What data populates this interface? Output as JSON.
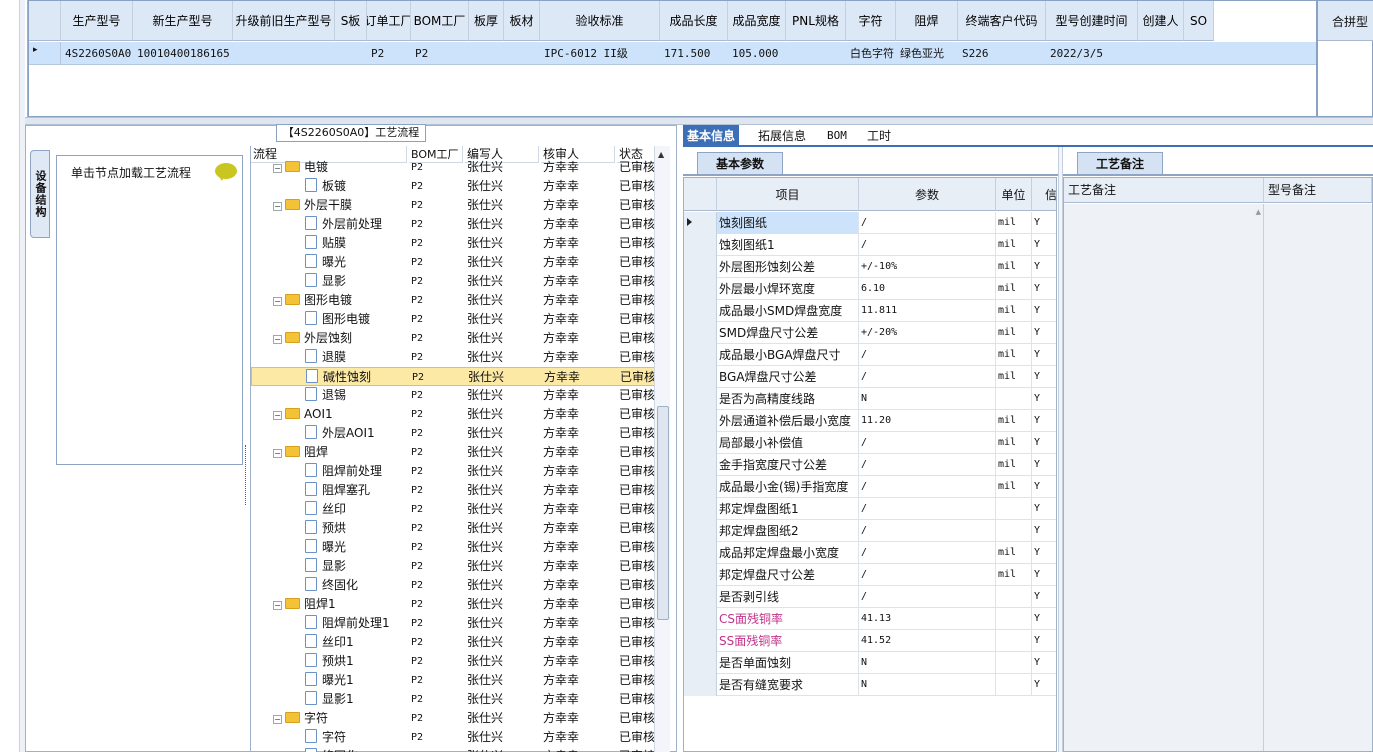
{
  "top_table": {
    "headers": [
      "生产型号",
      "新生产型号",
      "升级前旧生产型号",
      "S板",
      "订单工厂",
      "BOM工厂",
      "板厚",
      "板材",
      "验收标准",
      "成品长度",
      "成品宽度",
      "PNL规格",
      "字符",
      "阻焊",
      "终端客户代码",
      "型号创建时间",
      "创建人",
      "SO"
    ],
    "row": {
      "marker": "▸",
      "cells": [
        "4S2260S0A0",
        "10010400186165",
        "",
        "",
        "P2",
        "P2",
        "",
        "",
        "IPC-6012 II级",
        "171.500",
        "105.000",
        "",
        "白色字符",
        "绿色亚光",
        "S226",
        "2022/3/5",
        "",
        ""
      ]
    },
    "right_header": "合拼型"
  },
  "flow": {
    "title": "【4S2260S0A0】工艺流程",
    "vertical_tab": "设备结构",
    "node_hint": "单击节点加载工艺流程",
    "headers": [
      "流程",
      "BOM工厂",
      "编写人",
      "核审人",
      "状态"
    ],
    "rows": [
      {
        "name": "电镀",
        "type": "folder",
        "level": 0,
        "toggle": "−",
        "bom": "P2",
        "writer": "张仕兴",
        "reviewer": "方幸幸",
        "status": "已审核",
        "selected": false
      },
      {
        "name": "板镀",
        "type": "doc",
        "level": 1,
        "bom": "P2",
        "writer": "张仕兴",
        "reviewer": "方幸幸",
        "status": "已审核",
        "selected": false
      },
      {
        "name": "外层干膜",
        "type": "folder",
        "level": 0,
        "toggle": "−",
        "bom": "P2",
        "writer": "张仕兴",
        "reviewer": "方幸幸",
        "status": "已审核",
        "selected": false
      },
      {
        "name": "外层前处理",
        "type": "doc",
        "level": 1,
        "bom": "P2",
        "writer": "张仕兴",
        "reviewer": "方幸幸",
        "status": "已审核",
        "selected": false
      },
      {
        "name": "贴膜",
        "type": "doc",
        "level": 1,
        "bom": "P2",
        "writer": "张仕兴",
        "reviewer": "方幸幸",
        "status": "已审核",
        "selected": false
      },
      {
        "name": "曝光",
        "type": "doc",
        "level": 1,
        "bom": "P2",
        "writer": "张仕兴",
        "reviewer": "方幸幸",
        "status": "已审核",
        "selected": false
      },
      {
        "name": "显影",
        "type": "doc",
        "level": 1,
        "bom": "P2",
        "writer": "张仕兴",
        "reviewer": "方幸幸",
        "status": "已审核",
        "selected": false
      },
      {
        "name": "图形电镀",
        "type": "folder",
        "level": 0,
        "toggle": "−",
        "bom": "P2",
        "writer": "张仕兴",
        "reviewer": "方幸幸",
        "status": "已审核",
        "selected": false
      },
      {
        "name": "图形电镀",
        "type": "doc",
        "level": 1,
        "bom": "P2",
        "writer": "张仕兴",
        "reviewer": "方幸幸",
        "status": "已审核",
        "selected": false
      },
      {
        "name": "外层蚀刻",
        "type": "folder",
        "level": 0,
        "toggle": "−",
        "bom": "P2",
        "writer": "张仕兴",
        "reviewer": "方幸幸",
        "status": "已审核",
        "selected": false
      },
      {
        "name": "退膜",
        "type": "doc",
        "level": 1,
        "bom": "P2",
        "writer": "张仕兴",
        "reviewer": "方幸幸",
        "status": "已审核",
        "selected": false
      },
      {
        "name": "碱性蚀刻",
        "type": "doc",
        "level": 1,
        "bom": "P2",
        "writer": "张仕兴",
        "reviewer": "方幸幸",
        "status": "已审核",
        "selected": true
      },
      {
        "name": "退锡",
        "type": "doc",
        "level": 1,
        "bom": "P2",
        "writer": "张仕兴",
        "reviewer": "方幸幸",
        "status": "已审核",
        "selected": false
      },
      {
        "name": "AOI1",
        "type": "folder",
        "level": 0,
        "toggle": "−",
        "bom": "P2",
        "writer": "张仕兴",
        "reviewer": "方幸幸",
        "status": "已审核",
        "selected": false
      },
      {
        "name": "外层AOI1",
        "type": "doc",
        "level": 1,
        "bom": "P2",
        "writer": "张仕兴",
        "reviewer": "方幸幸",
        "status": "已审核",
        "selected": false
      },
      {
        "name": "阻焊",
        "type": "folder",
        "level": 0,
        "toggle": "−",
        "bom": "P2",
        "writer": "张仕兴",
        "reviewer": "方幸幸",
        "status": "已审核",
        "selected": false
      },
      {
        "name": "阻焊前处理",
        "type": "doc",
        "level": 1,
        "bom": "P2",
        "writer": "张仕兴",
        "reviewer": "方幸幸",
        "status": "已审核",
        "selected": false
      },
      {
        "name": "阻焊塞孔",
        "type": "doc",
        "level": 1,
        "bom": "P2",
        "writer": "张仕兴",
        "reviewer": "方幸幸",
        "status": "已审核",
        "selected": false
      },
      {
        "name": "丝印",
        "type": "doc",
        "level": 1,
        "bom": "P2",
        "writer": "张仕兴",
        "reviewer": "方幸幸",
        "status": "已审核",
        "selected": false
      },
      {
        "name": "预烘",
        "type": "doc",
        "level": 1,
        "bom": "P2",
        "writer": "张仕兴",
        "reviewer": "方幸幸",
        "status": "已审核",
        "selected": false
      },
      {
        "name": "曝光",
        "type": "doc",
        "level": 1,
        "bom": "P2",
        "writer": "张仕兴",
        "reviewer": "方幸幸",
        "status": "已审核",
        "selected": false
      },
      {
        "name": "显影",
        "type": "doc",
        "level": 1,
        "bom": "P2",
        "writer": "张仕兴",
        "reviewer": "方幸幸",
        "status": "已审核",
        "selected": false
      },
      {
        "name": "终固化",
        "type": "doc",
        "level": 1,
        "bom": "P2",
        "writer": "张仕兴",
        "reviewer": "方幸幸",
        "status": "已审核",
        "selected": false
      },
      {
        "name": "阻焊1",
        "type": "folder",
        "level": 0,
        "toggle": "−",
        "bom": "P2",
        "writer": "张仕兴",
        "reviewer": "方幸幸",
        "status": "已审核",
        "selected": false
      },
      {
        "name": "阻焊前处理1",
        "type": "doc",
        "level": 1,
        "bom": "P2",
        "writer": "张仕兴",
        "reviewer": "方幸幸",
        "status": "已审核",
        "selected": false
      },
      {
        "name": "丝印1",
        "type": "doc",
        "level": 1,
        "bom": "P2",
        "writer": "张仕兴",
        "reviewer": "方幸幸",
        "status": "已审核",
        "selected": false
      },
      {
        "name": "预烘1",
        "type": "doc",
        "level": 1,
        "bom": "P2",
        "writer": "张仕兴",
        "reviewer": "方幸幸",
        "status": "已审核",
        "selected": false
      },
      {
        "name": "曝光1",
        "type": "doc",
        "level": 1,
        "bom": "P2",
        "writer": "张仕兴",
        "reviewer": "方幸幸",
        "status": "已审核",
        "selected": false
      },
      {
        "name": "显影1",
        "type": "doc",
        "level": 1,
        "bom": "P2",
        "writer": "张仕兴",
        "reviewer": "方幸幸",
        "status": "已审核",
        "selected": false
      },
      {
        "name": "字符",
        "type": "folder",
        "level": 0,
        "toggle": "−",
        "bom": "P2",
        "writer": "张仕兴",
        "reviewer": "方幸幸",
        "status": "已审核",
        "selected": false
      },
      {
        "name": "字符",
        "type": "doc",
        "level": 1,
        "bom": "P2",
        "writer": "张仕兴",
        "reviewer": "方幸幸",
        "status": "已审核",
        "selected": false
      },
      {
        "name": "终固化",
        "type": "doc",
        "level": 1,
        "bom": "P2",
        "writer": "张仕兴",
        "reviewer": "方幸幸",
        "status": "已审核",
        "selected": false
      }
    ]
  },
  "right_tabs": [
    "基本信息",
    "拓展信息",
    "BOM",
    "工时"
  ],
  "basic": {
    "section_title": "基本参数",
    "headers": [
      "项目",
      "参数",
      "单位",
      "信"
    ],
    "rows": [
      {
        "item": "蚀刻图纸",
        "value": "/",
        "unit": "mil",
        "flag": "Y",
        "pink": false
      },
      {
        "item": "蚀刻图纸1",
        "value": "/",
        "unit": "mil",
        "flag": "Y",
        "pink": false
      },
      {
        "item": "外层图形蚀刻公差",
        "value": "+/-10%",
        "unit": "mil",
        "flag": "Y",
        "pink": false
      },
      {
        "item": "外层最小焊环宽度",
        "value": "6.10",
        "unit": "mil",
        "flag": "Y",
        "pink": false
      },
      {
        "item": "成品最小SMD焊盘宽度",
        "value": "11.811",
        "unit": "mil",
        "flag": "Y",
        "pink": false
      },
      {
        "item": "SMD焊盘尺寸公差",
        "value": "+/-20%",
        "unit": "mil",
        "flag": "Y",
        "pink": false
      },
      {
        "item": "成品最小BGA焊盘尺寸",
        "value": "/",
        "unit": "mil",
        "flag": "Y",
        "pink": false
      },
      {
        "item": "BGA焊盘尺寸公差",
        "value": "/",
        "unit": "mil",
        "flag": "Y",
        "pink": false
      },
      {
        "item": "是否为高精度线路",
        "value": "N",
        "unit": "",
        "flag": "Y",
        "pink": false
      },
      {
        "item": "外层通道补偿后最小宽度",
        "value": "11.20",
        "unit": "mil",
        "flag": "Y",
        "pink": false
      },
      {
        "item": "局部最小补偿值",
        "value": "/",
        "unit": "mil",
        "flag": "Y",
        "pink": false
      },
      {
        "item": "金手指宽度尺寸公差",
        "value": "/",
        "unit": "mil",
        "flag": "Y",
        "pink": false
      },
      {
        "item": "成品最小金(锡)手指宽度",
        "value": "/",
        "unit": "mil",
        "flag": "Y",
        "pink": false
      },
      {
        "item": "邦定焊盘图纸1",
        "value": "/",
        "unit": "",
        "flag": "Y",
        "pink": false
      },
      {
        "item": "邦定焊盘图纸2",
        "value": "/",
        "unit": "",
        "flag": "Y",
        "pink": false
      },
      {
        "item": "成品邦定焊盘最小宽度",
        "value": "/",
        "unit": "mil",
        "flag": "Y",
        "pink": false
      },
      {
        "item": "邦定焊盘尺寸公差",
        "value": "/",
        "unit": "mil",
        "flag": "Y",
        "pink": false
      },
      {
        "item": "是否剥引线",
        "value": "/",
        "unit": "",
        "flag": "Y",
        "pink": false
      },
      {
        "item": "CS面残铜率",
        "value": "41.13",
        "unit": "",
        "flag": "Y",
        "pink": true
      },
      {
        "item": "SS面残铜率",
        "value": "41.52",
        "unit": "",
        "flag": "Y",
        "pink": true
      },
      {
        "item": "是否单面蚀刻",
        "value": "N",
        "unit": "",
        "flag": "Y",
        "pink": false
      },
      {
        "item": "是否有缝宽要求",
        "value": "N",
        "unit": "",
        "flag": "Y",
        "pink": false
      }
    ]
  },
  "memo": {
    "section_title": "工艺备注",
    "headers": [
      "工艺备注",
      "型号备注"
    ]
  },
  "colors": {
    "accent": "#3c6fb6",
    "header_bg": "#dde8f6",
    "selected_row": "#cde3fb",
    "tree_selected": "#fde9a6",
    "pink_text": "#c0338a"
  }
}
